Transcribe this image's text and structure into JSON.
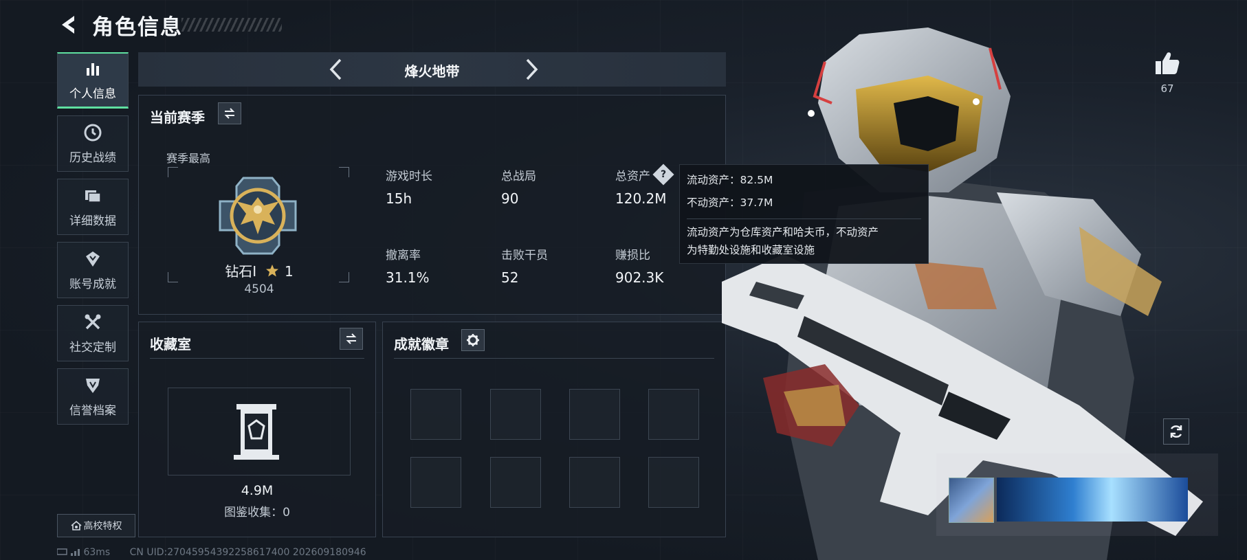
{
  "header": {
    "title": "角色信息"
  },
  "sidebar": {
    "items": [
      {
        "label": "个人信息",
        "active": true
      },
      {
        "label": "历史战绩"
      },
      {
        "label": "详细数据"
      },
      {
        "label": "账号成就"
      },
      {
        "label": "社交定制"
      },
      {
        "label": "信誉档案"
      }
    ],
    "campus_label": "高校特权"
  },
  "mode": {
    "title": "烽火地带"
  },
  "season": {
    "title": "当前赛季",
    "best_label": "赛季最高",
    "rank_name": "钻石I",
    "rank_stars": "1",
    "rank_score": "4504",
    "stats": [
      {
        "label": "游戏时长",
        "value": "15h"
      },
      {
        "label": "总战局",
        "value": "90"
      },
      {
        "label": "总资产",
        "value": "120.2M"
      },
      {
        "label": "撤离率",
        "value": "31.1%"
      },
      {
        "label": "击败干员",
        "value": "52"
      },
      {
        "label": "赚损比",
        "value": "902.3K"
      }
    ],
    "help_glyph": "?"
  },
  "tooltip": {
    "liquid": "流动资产：82.5M",
    "fixed": "不动资产：37.7M",
    "desc_line1": "流动资产为仓库资产和哈夫币，不动资产",
    "desc_line2": "为特勤处设施和收藏室设施"
  },
  "collection": {
    "title": "收藏室",
    "value": "4.9M",
    "sub": "图鉴收集：0"
  },
  "badges": {
    "title": "成就徽章"
  },
  "likes": {
    "count": "67"
  },
  "footer": {
    "ping": "63ms",
    "uid": "CN UID:27045954392258617400 202609180946"
  },
  "colors": {
    "accent": "#5fe0a0",
    "gold": "#d9b25a"
  }
}
